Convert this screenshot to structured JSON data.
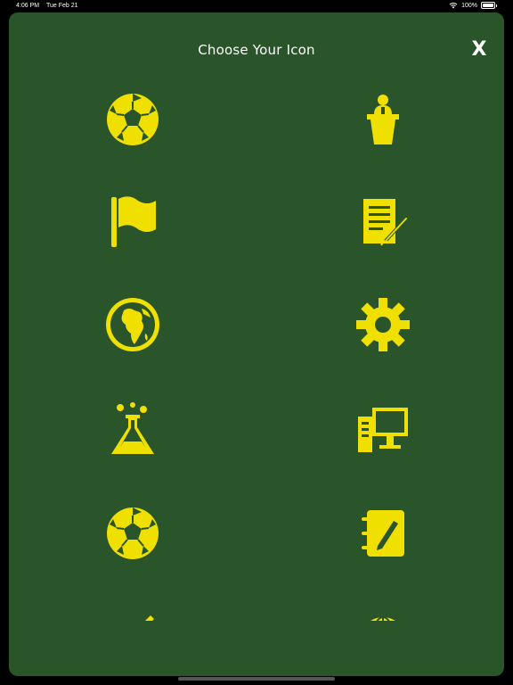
{
  "status_bar": {
    "time": "4:06 PM",
    "date": "Tue Feb 21",
    "battery": "100%"
  },
  "modal": {
    "title": "Choose Your Icon",
    "close_label": "X"
  },
  "colors": {
    "background": "#2a5429",
    "icon": "#f0e000",
    "title": "#ffffff"
  },
  "icons": [
    {
      "name": "soccer-ball-icon"
    },
    {
      "name": "speaker-podium-icon"
    },
    {
      "name": "flag-icon"
    },
    {
      "name": "document-signature-icon"
    },
    {
      "name": "globe-africa-icon"
    },
    {
      "name": "gear-icon"
    },
    {
      "name": "science-flask-icon"
    },
    {
      "name": "desktop-computer-icon"
    },
    {
      "name": "soccer-ball-icon"
    },
    {
      "name": "notebook-pen-icon"
    },
    {
      "name": "pencil-icon"
    },
    {
      "name": "globe-icon"
    }
  ]
}
